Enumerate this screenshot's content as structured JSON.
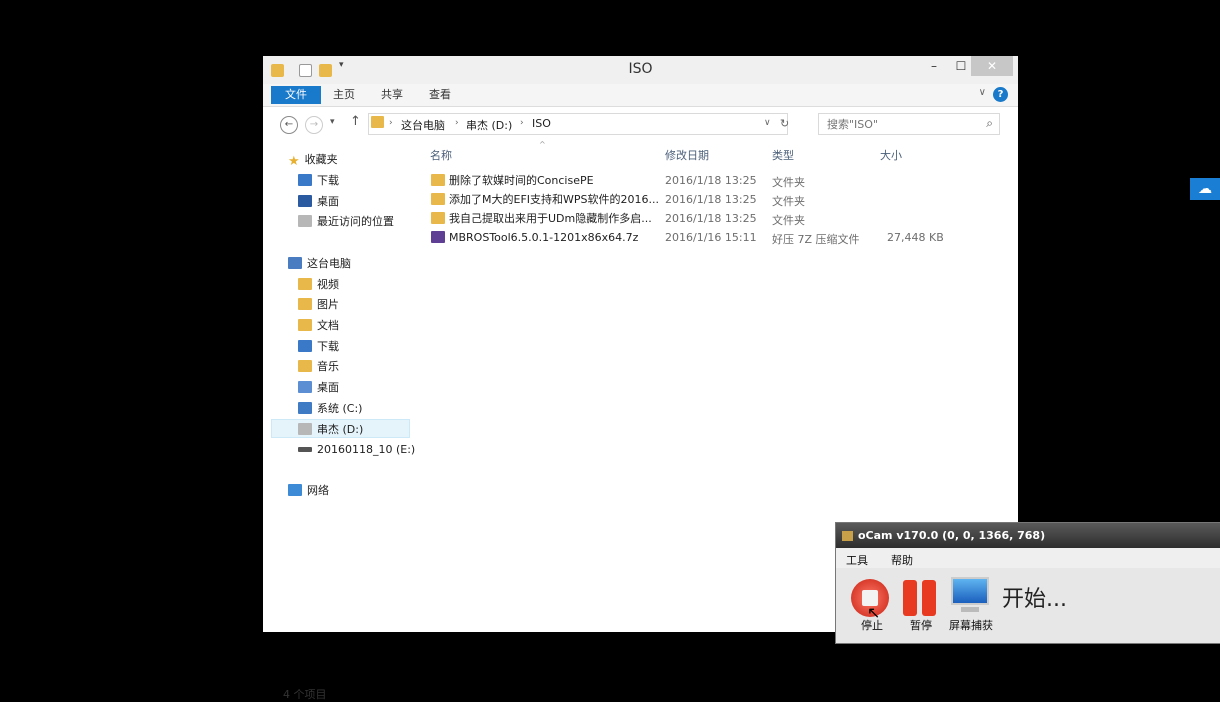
{
  "explorer": {
    "title": "ISO",
    "ribbon_tabs": [
      "文件",
      "主页",
      "共享",
      "查看"
    ],
    "help": "?",
    "address": {
      "crumbs": [
        "这台电脑",
        "串杰 (D:)",
        "ISO"
      ]
    },
    "search": {
      "placeholder": "搜索\"ISO\""
    },
    "sidebar": {
      "favorites": {
        "label": "收藏夹",
        "items": [
          "下载",
          "桌面",
          "最近访问的位置"
        ]
      },
      "thispc": {
        "label": "这台电脑",
        "items": [
          "视频",
          "图片",
          "文档",
          "下载",
          "音乐",
          "桌面",
          "系统 (C:)",
          "串杰 (D:)",
          "20160118_10 (E:)"
        ]
      },
      "network": {
        "label": "网络"
      }
    },
    "columns": {
      "name": "名称",
      "modified": "修改日期",
      "type": "类型",
      "size": "大小"
    },
    "files": [
      {
        "name": "删除了软媒时间的ConcisePE",
        "modified": "2016/1/18 13:25",
        "type": "文件夹",
        "size": "",
        "icon": "folder-icon"
      },
      {
        "name": "添加了M大的EFI支持和WPS软件的2016...",
        "modified": "2016/1/18 13:25",
        "type": "文件夹",
        "size": "",
        "icon": "folder-icon"
      },
      {
        "name": "我自己提取出来用于UDm隐藏制作多启...",
        "modified": "2016/1/18 13:25",
        "type": "文件夹",
        "size": "",
        "icon": "folder-icon"
      },
      {
        "name": "MBROSTool6.5.0.1-1201x86x64.7z",
        "modified": "2016/1/16 15:11",
        "type": "好压 7Z 压缩文件",
        "size": "27,448 KB",
        "icon": "archive-icon"
      }
    ],
    "status": "4 个项目"
  },
  "ocam": {
    "title": "oCam v170.0 (0, 0, 1366, 768)",
    "menu": [
      "工具",
      "帮助"
    ],
    "stop_label": "停止",
    "pause_label": "暂停",
    "capture_label": "屏幕捕获",
    "status_text": "开始..."
  }
}
